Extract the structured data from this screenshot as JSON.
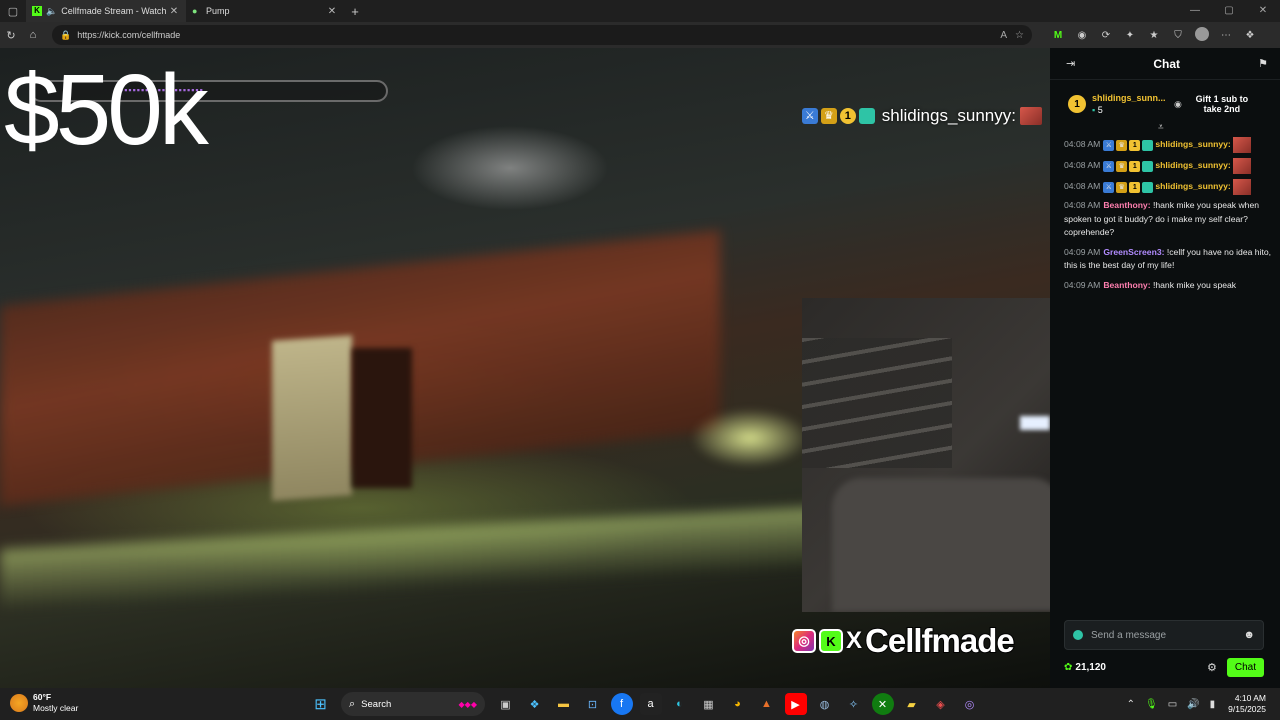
{
  "browser": {
    "tabs": [
      {
        "title": "Cellfmade Stream - Watch L",
        "active": true
      },
      {
        "title": "Pump",
        "active": false
      }
    ],
    "url": "https://kick.com/cellfmade"
  },
  "stream": {
    "overlay_amount": "$50k",
    "alert_username": "shlidings_sunnyy:",
    "socials_handle": "Cellfmade",
    "socials_x": "X"
  },
  "chat": {
    "title": "Chat",
    "pinned": {
      "rank": "1",
      "username": "shlidings_sunn...",
      "sub_count": "5",
      "gift_text": "Gift 1 sub to take 2nd"
    },
    "messages": [
      {
        "time": "04:08 AM",
        "user": "shlidings_sunnyy:",
        "text": "",
        "color": "#f1c232",
        "badges": true,
        "emote": true
      },
      {
        "time": "04:08 AM",
        "user": "shlidings_sunnyy:",
        "text": "",
        "color": "#f1c232",
        "badges": true,
        "emote": true
      },
      {
        "time": "04:08 AM",
        "user": "shlidings_sunnyy:",
        "text": "",
        "color": "#f1c232",
        "badges": true,
        "emote": true
      },
      {
        "time": "04:08 AM",
        "user": "Beanthony:",
        "text": "!hank mike you speak when spoken to got it buddy? do i make my self clear? coprehende?",
        "color": "#ff7fb0",
        "badges": false,
        "emote": false
      },
      {
        "time": "04:09 AM",
        "user": "GreenScreen3:",
        "text": "!cellf you have no idea hito, this is the best day of my life!",
        "color": "#b28cff",
        "badges": false,
        "emote": false
      },
      {
        "time": "04:09 AM",
        "user": "Beanthony:",
        "text": "!hank mike you speak",
        "color": "#ff7fb0",
        "badges": false,
        "emote": false
      }
    ],
    "input_placeholder": "Send a message",
    "points": "21,120",
    "send_label": "Chat"
  },
  "taskbar": {
    "weather_temp": "60°F",
    "weather_desc": "Mostly clear",
    "search_label": "Search",
    "time": "4:10 AM",
    "date": "9/15/2025"
  },
  "colors": {
    "kick_green": "#53fc18",
    "gold": "#f1c232"
  }
}
